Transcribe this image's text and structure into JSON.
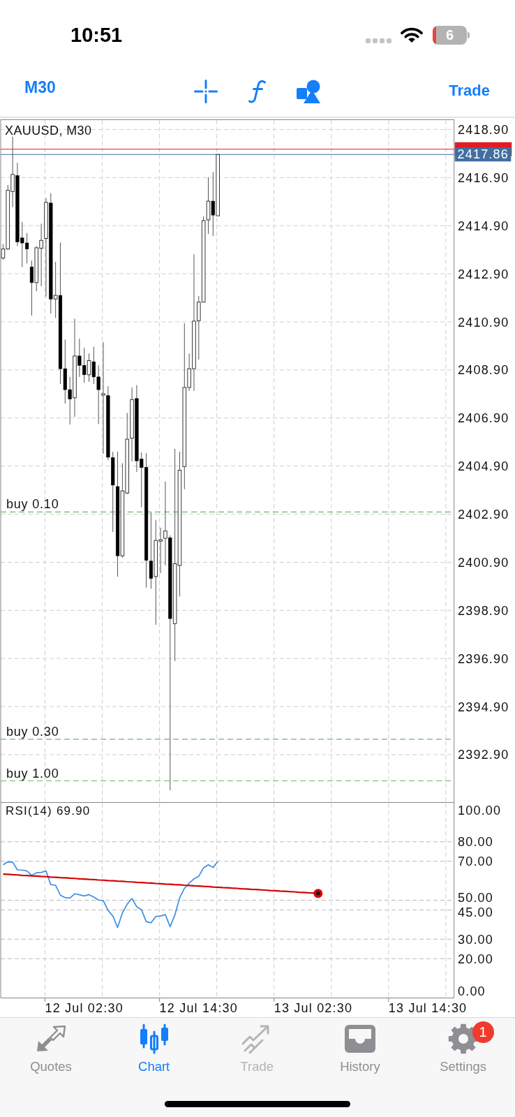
{
  "status_bar": {
    "time": "10:51",
    "battery": "6"
  },
  "toolbar": {
    "timeframe": "M30",
    "action": "Trade"
  },
  "chart": {
    "chart_data": {
      "type": "candlestick",
      "title": "XAUUSD, M30",
      "categories": [
        null,
        null,
        null,
        null,
        null,
        null,
        null,
        null,
        null,
        null,
        null,
        null,
        null,
        null,
        null,
        null,
        null,
        null,
        null,
        null,
        null,
        null,
        null,
        null,
        null,
        null,
        null,
        null,
        null,
        null,
        null,
        null,
        null,
        null,
        null,
        null,
        null,
        null,
        null,
        null,
        null,
        null,
        null,
        null,
        null,
        null,
        null,
        null,
        null,
        null,
        null,
        null,
        null,
        null,
        null,
        null,
        null,
        null,
        null,
        null,
        null,
        null,
        null,
        null,
        null,
        null,
        null,
        null,
        null,
        null,
        null,
        null,
        null,
        null,
        null,
        null,
        null,
        null,
        null,
        null,
        null,
        null,
        null,
        null,
        null,
        null,
        null,
        null,
        null,
        null,
        null,
        null,
        null,
        null,
        null
      ],
      "ohlc": [
        [
          2413.55,
          2414.13,
          2413.49,
          2413.93
        ],
        [
          2413.93,
          2416.59,
          2413.89,
          2416.37
        ],
        [
          2416.32,
          2418.6,
          2415.67,
          2417.03
        ],
        [
          2416.98,
          2417.51,
          2414.05,
          2414.22
        ],
        [
          2414.39,
          2415.06,
          2413.18,
          2414.18
        ],
        [
          2414.18,
          2414.59,
          2413.33,
          2413.93
        ],
        [
          2413.18,
          2413.45,
          2411.16,
          2412.53
        ],
        [
          2412.53,
          2414.05,
          2412.17,
          2413.98
        ],
        [
          2413.96,
          2414.98,
          2412.38,
          2414.29
        ],
        [
          2414.37,
          2416.04,
          2411.95,
          2415.87
        ],
        [
          2415.84,
          2416.25,
          2411.24,
          2411.85
        ],
        [
          2411.85,
          2413.4,
          2411.06,
          2412.0
        ],
        [
          2412.0,
          2414.2,
          2408.32,
          2408.95
        ],
        [
          2408.95,
          2410.16,
          2407.5,
          2408.08
        ],
        [
          2408.08,
          2408.61,
          2406.63,
          2407.69
        ],
        [
          2407.74,
          2411.03,
          2406.95,
          2409.48
        ],
        [
          2409.48,
          2410.21,
          2408.61,
          2409.09
        ],
        [
          2409.09,
          2409.82,
          2408.37,
          2408.7
        ],
        [
          2408.7,
          2409.58,
          2408.41,
          2409.29
        ],
        [
          2409.24,
          2409.87,
          2408.32,
          2408.61
        ],
        [
          2408.61,
          2409.09,
          2406.65,
          2408.08
        ],
        [
          2407.85,
          2410.06,
          2405.41,
          2407.91
        ],
        [
          2407.83,
          2408.22,
          2405.15,
          2405.27
        ],
        [
          2405.25,
          2405.5,
          2402.16,
          2404.11
        ],
        [
          2404.05,
          2405.5,
          2400.3,
          2401.17
        ],
        [
          2401.17,
          2405.02,
          2401.09,
          2403.87
        ],
        [
          2403.78,
          2407.11,
          2403.73,
          2406.02
        ],
        [
          2406.06,
          2408.17,
          2405.1,
          2407.67
        ],
        [
          2407.71,
          2408.27,
          2404.66,
          2405.12
        ],
        [
          2405.19,
          2405.47,
          2403.19,
          2404.84
        ],
        [
          2404.85,
          2405.44,
          2399.85,
          2400.98
        ],
        [
          2400.95,
          2402.97,
          2399.8,
          2400.23
        ],
        [
          2400.31,
          2402.66,
          2398.3,
          2401.81
        ],
        [
          2401.78,
          2402.34,
          2400.45,
          2401.84
        ],
        [
          2401.9,
          2404.26,
          2400.77,
          2402.2
        ],
        [
          2401.92,
          2402.02,
          2391.42,
          2398.56
        ],
        [
          2398.35,
          2405.62,
          2396.79,
          2400.84
        ],
        [
          2400.77,
          2405.5,
          2399.48,
          2404.73
        ],
        [
          2404.88,
          2410.84,
          2403.94,
          2408.17
        ],
        [
          2408.17,
          2409.58,
          2408.03,
          2408.95
        ],
        [
          2408.95,
          2413.71,
          2408.03,
          2410.93
        ],
        [
          2410.95,
          2411.97,
          2409.33,
          2411.72
        ],
        [
          2411.72,
          2415.29,
          2411.72,
          2415.11
        ],
        [
          2415.14,
          2416.91,
          2414.56,
          2415.92
        ],
        [
          2415.92,
          2417.13,
          2414.47,
          2415.34
        ],
        [
          2415.31,
          2417.88,
          2415.31,
          2417.86
        ],
        null,
        null,
        null,
        null,
        null,
        null,
        null,
        null,
        null,
        null,
        null,
        null,
        null,
        null,
        null,
        null,
        null,
        null,
        null,
        null,
        null,
        null,
        null,
        null,
        null,
        null,
        null,
        null,
        null,
        null,
        null,
        null,
        null,
        null,
        null,
        null,
        null,
        null,
        null,
        null,
        null,
        null,
        null,
        null,
        null,
        null,
        null,
        null,
        null
      ],
      "ylim": [
        2390.91,
        2419.32
      ],
      "yticks": [
        {
          "value": 2418.9,
          "label": "2418.90"
        },
        {
          "value": 2416.9,
          "label": "2416.90"
        },
        {
          "value": 2414.9,
          "label": "2414.90"
        },
        {
          "value": 2412.9,
          "label": "2412.90"
        },
        {
          "value": 2410.9,
          "label": "2410.90"
        },
        {
          "value": 2408.9,
          "label": "2408.90"
        },
        {
          "value": 2406.9,
          "label": "2406.90"
        },
        {
          "value": 2404.9,
          "label": "2404.90"
        },
        {
          "value": 2402.9,
          "label": "2402.90"
        },
        {
          "value": 2400.9,
          "label": "2400.90"
        },
        {
          "value": 2398.9,
          "label": "2398.90"
        },
        {
          "value": 2396.9,
          "label": "2396.90"
        },
        {
          "value": 2394.9,
          "label": "2394.90"
        },
        {
          "value": 2392.9,
          "label": "2392.90"
        }
      ],
      "ref_lines": [
        {
          "axis": "y",
          "value": 2418.08,
          "color": "#e31b23"
        },
        {
          "axis": "y",
          "value": 2417.86,
          "color": "#3f70a1",
          "label": "2417.86"
        },
        {
          "axis": "y",
          "value": 2402.99,
          "color": "#72b472",
          "label": "buy 0.10"
        },
        {
          "axis": "y",
          "value": 2393.54,
          "color": "#72b472",
          "label": "buy 0.30"
        },
        {
          "axis": "y",
          "value": 2391.81,
          "color": "#72b472",
          "label": "buy 1.00"
        }
      ],
      "grid": true
    },
    "indicator": {
      "chart_data": {
        "type": "line",
        "title": "RSI(14) 69.90",
        "categories": [
          null,
          null,
          null,
          null,
          null,
          null,
          null,
          null,
          null,
          null,
          null,
          null,
          null,
          null,
          null,
          null,
          null,
          "12 Jul 02:30",
          null,
          null,
          null,
          null,
          null,
          null,
          null,
          null,
          null,
          null,
          null,
          null,
          null,
          null,
          null,
          null,
          null,
          null,
          null,
          null,
          null,
          null,
          null,
          "12 Jul 14:30",
          null,
          null,
          null,
          null,
          null,
          null,
          null,
          null,
          null,
          null,
          null,
          null,
          null,
          null,
          null,
          null,
          null,
          null,
          null,
          null,
          null,
          null,
          null,
          "13 Jul 02:30",
          null,
          null,
          null,
          null,
          null,
          null,
          null,
          null,
          null,
          null,
          null,
          null,
          null,
          null,
          null,
          null,
          null,
          null,
          null,
          null,
          null,
          null,
          null,
          "13 Jul 14:30",
          null,
          null,
          null,
          null,
          null
        ],
        "series": [
          {
            "color": "#3d8fe2",
            "values": [
              68.2,
              69.7,
              69.6,
              65.6,
              65.5,
              65.0,
              62.8,
              64.1,
              64.3,
              65.0,
              58.0,
              57.7,
              52.6,
              51.3,
              51.1,
              53.3,
              52.8,
              52.2,
              52.9,
              51.6,
              50.1,
              49.8,
              44.8,
              41.9,
              36.0,
              43.5,
              48.0,
              50.9,
              46.7,
              45.1,
              39.0,
              38.4,
              41.7,
              41.9,
              42.6,
              36.4,
              42.5,
              51.2,
              56.1,
              58.8,
              61.0,
              62.3,
              66.6,
              68.2,
              66.8,
              69.9,
              null,
              null,
              null,
              null,
              null,
              null,
              null,
              null,
              null,
              null,
              null,
              null,
              null,
              null,
              null,
              null,
              null,
              null,
              null,
              null,
              null,
              null,
              null,
              null,
              null,
              null,
              null,
              null,
              null,
              null,
              null,
              null,
              null,
              null,
              null,
              null,
              null,
              null,
              null,
              null,
              null,
              null,
              null,
              null,
              null,
              null,
              null,
              null,
              null
            ]
          },
          {
            "color": "#d60000",
            "values": [
              63.4,
              63.3,
              63.1,
              63.0,
              62.8,
              62.7,
              62.5,
              62.4,
              62.2,
              62.1,
              61.9,
              61.8,
              61.6,
              61.5,
              61.3,
              61.2,
              61.0,
              60.9,
              60.7,
              60.6,
              60.4,
              60.3,
              60.1,
              60.0,
              59.8,
              59.7,
              59.5,
              59.4,
              59.2,
              59.1,
              58.9,
              58.8,
              58.6,
              58.5,
              58.3,
              58.2,
              58.0,
              57.9,
              57.7,
              57.6,
              57.4,
              57.3,
              57.1,
              57.0,
              56.8,
              56.7,
              56.5,
              56.4,
              56.2,
              56.1,
              55.9,
              55.8,
              55.6,
              55.5,
              55.3,
              55.2,
              55.0,
              54.9,
              54.7,
              54.6,
              54.4,
              54.3,
              54.1,
              54.0,
              53.8,
              53.7,
              53.5,
              null,
              null,
              null,
              null,
              null,
              null,
              null,
              null,
              null,
              null,
              null,
              null,
              null,
              null,
              null,
              null,
              null,
              null,
              null,
              null,
              null,
              null,
              null,
              null,
              null,
              null,
              null,
              null
            ]
          }
        ],
        "ylim": [
          0,
          100
        ],
        "yticks": [
          {
            "value": 100,
            "label": "100.00"
          },
          {
            "value": 80,
            "label": "80.00"
          },
          {
            "value": 70,
            "label": "70.00"
          },
          {
            "value": 50,
            "label": "50.00"
          },
          {
            "value": 45,
            "label": "45.00"
          },
          {
            "value": 30,
            "label": "30.00"
          },
          {
            "value": 20,
            "label": "20.00"
          },
          {
            "value": 0,
            "label": "0.00"
          }
        ],
        "grid": true
      }
    }
  },
  "tab_bar": {
    "tabs": [
      {
        "label": "Quotes",
        "selected": false,
        "disabled": false
      },
      {
        "label": "Chart",
        "selected": true,
        "disabled": false
      },
      {
        "label": "Trade",
        "selected": false,
        "disabled": true
      },
      {
        "label": "History",
        "selected": false,
        "disabled": false
      },
      {
        "label": "Settings",
        "selected": false,
        "disabled": false,
        "badge": "1"
      }
    ]
  }
}
